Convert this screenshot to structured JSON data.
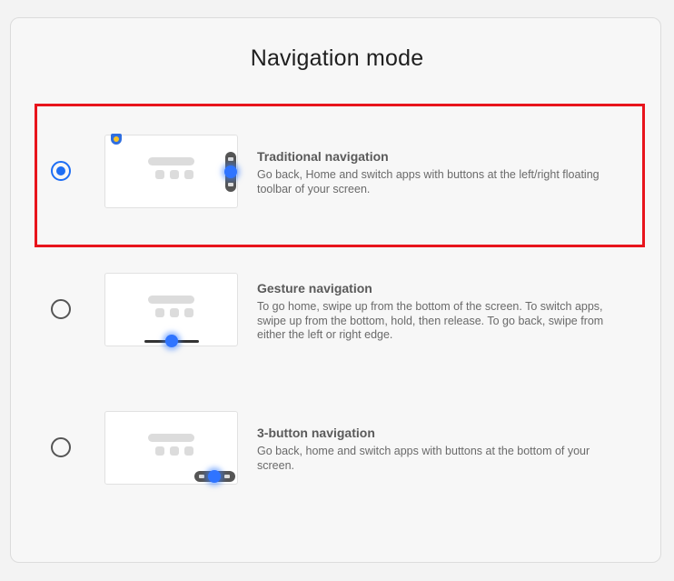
{
  "dialog": {
    "title": "Navigation mode"
  },
  "options": [
    {
      "title": "Traditional navigation",
      "description": "Go back, Home and switch apps with buttons at the left/right floating toolbar of your screen.",
      "selected": true
    },
    {
      "title": "Gesture navigation",
      "description": "To go home, swipe up from the bottom of the screen. To switch apps, swipe up from the bottom, hold, then release. To go back, swipe from either the left or right edge.",
      "selected": false
    },
    {
      "title": "3-button navigation",
      "description": "Go back, home and switch apps with buttons at the bottom of your screen.",
      "selected": false
    }
  ],
  "colors": {
    "accent": "#1e6ef4",
    "highlight": "#e8141c"
  },
  "icons": [
    "shield-icon",
    "back-icon",
    "home-icon",
    "recents-icon"
  ]
}
